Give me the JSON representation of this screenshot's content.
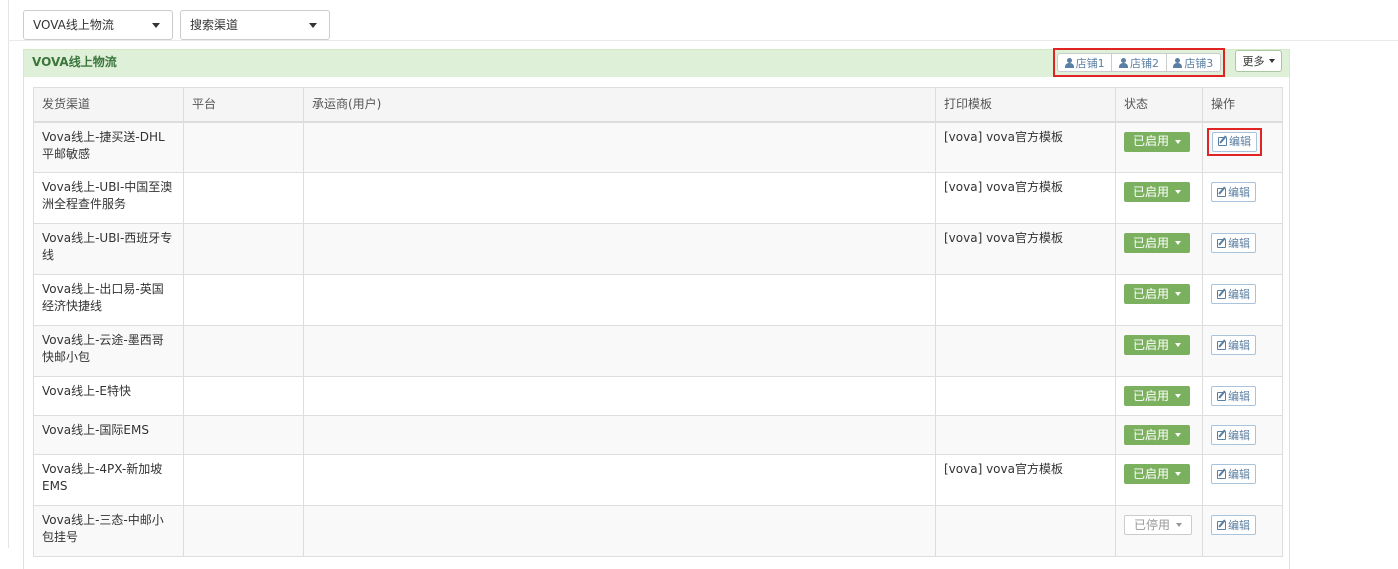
{
  "filters": {
    "logistics_select": "VOVA线上物流",
    "channel_select": "搜索渠道"
  },
  "panel": {
    "title": "VOVA线上物流",
    "shops": [
      "店铺1",
      "店铺2",
      "店铺3"
    ],
    "more_label": "更多"
  },
  "table": {
    "headers": [
      "发货渠道",
      "平台",
      "承运商(用户)",
      "打印模板",
      "状态",
      "操作"
    ],
    "edit_label": "编辑",
    "rows": [
      {
        "channel": "Vova线上-捷买送-DHL平邮敏感",
        "platform": "",
        "carrier": "",
        "template": "[vova] vova官方模板",
        "status": "已启用",
        "enabled": true
      },
      {
        "channel": "Vova线上-UBI-中国至澳洲全程查件服务",
        "platform": "",
        "carrier": "",
        "template": "[vova] vova官方模板",
        "status": "已启用",
        "enabled": true
      },
      {
        "channel": "Vova线上-UBI-西班牙专线",
        "platform": "",
        "carrier": "",
        "template": "[vova] vova官方模板",
        "status": "已启用",
        "enabled": true
      },
      {
        "channel": "Vova线上-出口易-英国经济快捷线",
        "platform": "",
        "carrier": "",
        "template": "",
        "status": "已启用",
        "enabled": true
      },
      {
        "channel": "Vova线上-云途-墨西哥快邮小包",
        "platform": "",
        "carrier": "",
        "template": "",
        "status": "已启用",
        "enabled": true
      },
      {
        "channel": "Vova线上-E特快",
        "platform": "",
        "carrier": "",
        "template": "",
        "status": "已启用",
        "enabled": true
      },
      {
        "channel": "Vova线上-国际EMS",
        "platform": "",
        "carrier": "",
        "template": "",
        "status": "已启用",
        "enabled": true
      },
      {
        "channel": "Vova线上-4PX-新加坡EMS",
        "platform": "",
        "carrier": "",
        "template": "[vova] vova官方模板",
        "status": "已启用",
        "enabled": true
      },
      {
        "channel": "Vova线上-三态-中邮小包挂号",
        "platform": "",
        "carrier": "",
        "template": "",
        "status": "已停用",
        "enabled": false
      }
    ]
  },
  "colors": {
    "panel_header_bg": "#dff0d8",
    "panel_title": "#3c763d",
    "status_enabled": "#7bb15e",
    "highlight": "#e02424"
  }
}
